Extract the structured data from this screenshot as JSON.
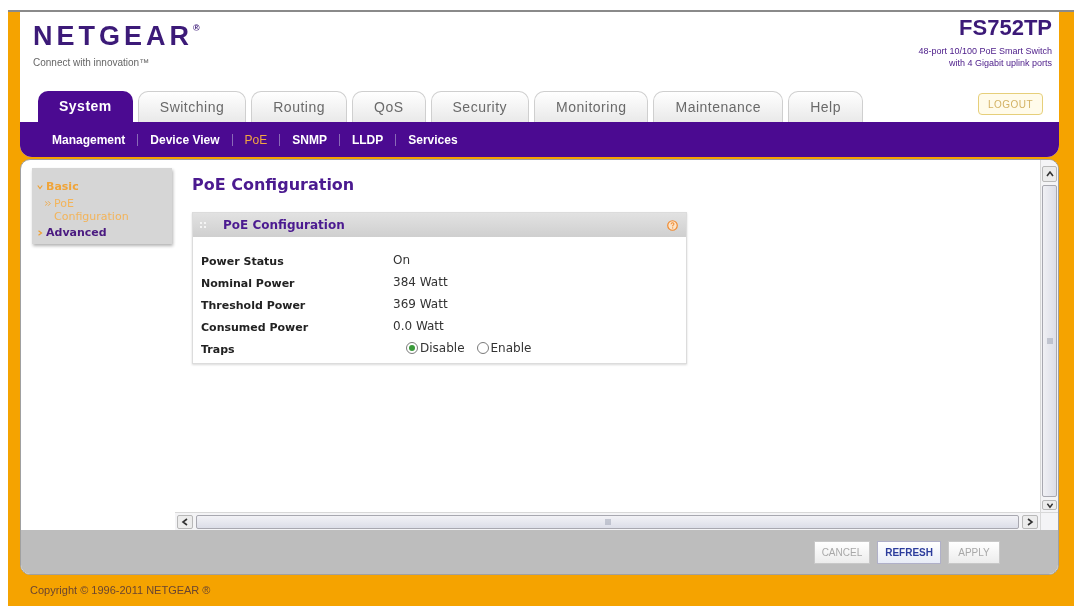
{
  "header": {
    "logo": "NETGEAR$^{®}$",
    "tagline": "Connect with innovation™",
    "model": "FS752TP",
    "description": [
      "48-port 10/100 PoE Smart Switch",
      "with 4 Gigabit uplink ports"
    ]
  },
  "tabs": [
    {
      "label": "System",
      "selected": true
    },
    {
      "label": "Switching",
      "selected": false
    },
    {
      "label": "Routing",
      "selected": false
    },
    {
      "label": "QoS",
      "selected": false
    },
    {
      "label": "Security",
      "selected": false
    },
    {
      "label": "Monitoring",
      "selected": false
    },
    {
      "label": "Maintenance",
      "selected": false
    },
    {
      "label": "Help",
      "selected": false
    }
  ],
  "logout_button": "LOGOUT",
  "subnav": [
    {
      "label": "Management",
      "selected": false
    },
    {
      "label": "Device View",
      "selected": false
    },
    {
      "label": "PoE",
      "selected": true
    },
    {
      "label": "SNMP",
      "selected": false
    },
    {
      "label": "LLDP",
      "selected": false
    },
    {
      "label": "Services",
      "selected": false
    }
  ],
  "sidebar": {
    "items": [
      {
        "label": "Basic",
        "selected": true,
        "expanded": true,
        "children": [
          {
            "label": "PoE Configuration",
            "selected": true
          }
        ]
      },
      {
        "label": "Advanced",
        "selected": false,
        "expanded": false
      }
    ]
  },
  "page_title": "PoE Configuration",
  "panel": {
    "title": "PoE Configuration",
    "rows": [
      {
        "kind": "text",
        "label": "Power Status",
        "value": "On"
      },
      {
        "kind": "text",
        "label": "Nominal Power",
        "value": "384 Watt"
      },
      {
        "kind": "text",
        "label": "Threshold Power",
        "value": "369 Watt"
      },
      {
        "kind": "text",
        "label": "Consumed Power",
        "value": "0.0 Watt"
      },
      {
        "kind": "radio",
        "label": "Traps",
        "options": [
          {
            "label": "Disable",
            "selected": true
          },
          {
            "label": "Enable",
            "selected": false
          }
        ]
      }
    ]
  },
  "buttons": [
    {
      "label": "CANCEL",
      "disabled": true
    },
    {
      "label": "REFRESH",
      "disabled": false
    },
    {
      "label": "APPLY",
      "disabled": true
    }
  ],
  "footer": "Copyright © 1996-2011 NETGEAR ®"
}
